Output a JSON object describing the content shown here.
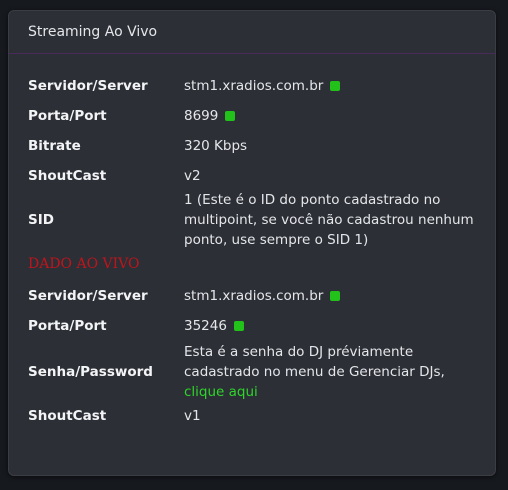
{
  "panel": {
    "title": "Streaming Ao Vivo"
  },
  "streaming": {
    "rows": [
      {
        "label": "Servidor/Server",
        "value": "stm1.xradios.com.br",
        "status": "online"
      },
      {
        "label": "Porta/Port",
        "value": "8699",
        "status": "online"
      },
      {
        "label": "Bitrate",
        "value": "320 Kbps"
      },
      {
        "label": "ShoutCast",
        "value": "v2"
      },
      {
        "label": "SID",
        "value": "1 (Este é o ID do ponto cadastrado no multipoint, se você não cadastrou nenhum ponto, use sempre o SID 1)"
      }
    ]
  },
  "live": {
    "section_title": "DADO AO VIVO",
    "rows": [
      {
        "label": "Servidor/Server",
        "value": "stm1.xradios.com.br",
        "status": "online"
      },
      {
        "label": "Porta/Port",
        "value": "35246",
        "status": "online"
      },
      {
        "label": "Senha/Password",
        "value": "Esta é a senha do DJ préviamente cadastrado no menu de Gerenciar DJs,",
        "link": "clique aqui"
      },
      {
        "label": "ShoutCast",
        "value": "v1"
      }
    ]
  },
  "colors": {
    "status_online": "#22c21a",
    "section_title": "#c0141c",
    "link": "#2ed52a"
  }
}
